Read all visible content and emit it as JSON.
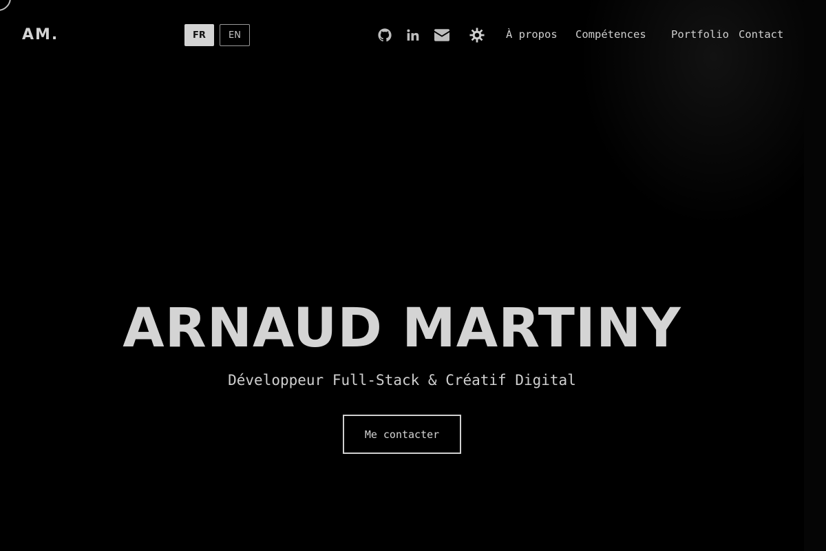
{
  "brand": {
    "logo_text": "AM."
  },
  "language_switch": {
    "fr_label": "FR",
    "en_label": "EN",
    "active": "FR"
  },
  "social_icons": [
    "github-icon",
    "linkedin-icon",
    "mail-icon"
  ],
  "theme_toggle": {
    "icon": "sun-icon"
  },
  "nav": {
    "items": [
      {
        "label": "À propos"
      },
      {
        "label": "Compétences"
      },
      {
        "label": "Portfolio"
      },
      {
        "label": "Contact"
      }
    ]
  },
  "hero": {
    "title": "ARNAUD MARTINY",
    "subtitle": "Développeur Full-Stack & Créatif Digital",
    "cta_label": "Me contacter"
  },
  "colors": {
    "background": "#000000",
    "text": "#d4d4d4",
    "accent_button_bg": "#d4d4d4"
  }
}
